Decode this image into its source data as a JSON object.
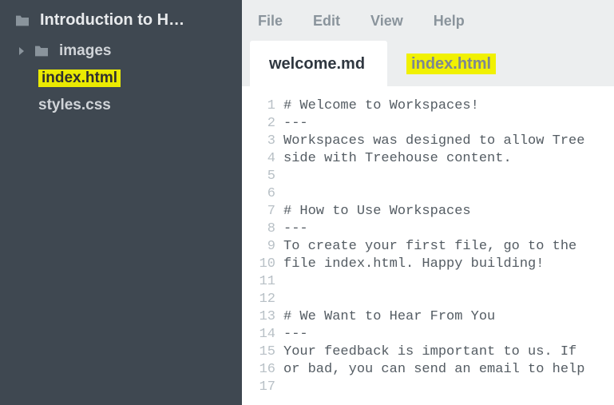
{
  "sidebar": {
    "root": "Introduction to H…",
    "items": [
      {
        "type": "folder",
        "label": "images"
      },
      {
        "type": "file",
        "label": "index.html",
        "highlighted": true
      },
      {
        "type": "file",
        "label": "styles.css"
      }
    ]
  },
  "menu": {
    "file": "File",
    "edit": "Edit",
    "view": "View",
    "help": "Help"
  },
  "tabs": [
    {
      "label": "welcome.md",
      "active": true
    },
    {
      "label": "index.html",
      "highlighted": true
    }
  ],
  "editor": {
    "lines": [
      "# Welcome to Workspaces!",
      "---",
      "Workspaces was designed to allow Tree",
      "side with Treehouse content.",
      "",
      "",
      "# How to Use Workspaces",
      "---",
      "To create your first file, go to the ",
      "file index.html. Happy building!",
      "",
      "",
      "# We Want to Hear From You",
      "---",
      "Your feedback is important to us. If ",
      "or bad, you can send an email to help",
      ""
    ]
  },
  "icons": {
    "folder": "folder-icon",
    "caret": "caret-right-icon"
  }
}
